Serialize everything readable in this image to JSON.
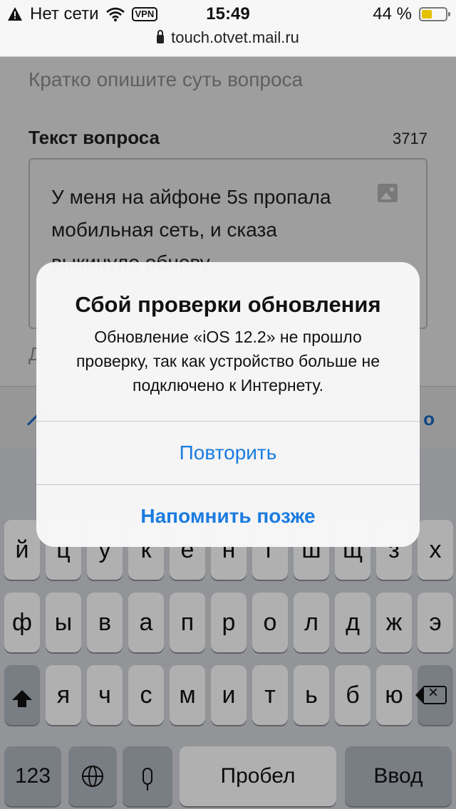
{
  "status_bar": {
    "carrier": "Нет сети",
    "vpn_label": "VPN",
    "time": "15:49",
    "battery_text": "44 %",
    "battery_level": 0.44,
    "url": "touch.otvet.mail.ru"
  },
  "form": {
    "summary_placeholder": "Кратко опишите суть вопроса",
    "question_label": "Текст вопроса",
    "char_counter": "3717",
    "question_text": "У меня на айфоне 5s пропала мобильная сеть, и сказа выкинуло обнову",
    "partial_label": "Д",
    "toolbar_partial": "о"
  },
  "alert": {
    "title": "Сбой проверки обновления",
    "message": "Обновление «iOS 12.2» не прошло проверку, так как устройство больше не подключено к Интернету.",
    "retry_label": "Повторить",
    "later_label": "Напомнить позже"
  },
  "keyboard": {
    "row1": [
      "й",
      "ц",
      "у",
      "к",
      "е",
      "н",
      "г",
      "ш",
      "щ",
      "з",
      "х"
    ],
    "row2": [
      "ф",
      "ы",
      "в",
      "а",
      "п",
      "р",
      "о",
      "л",
      "д",
      "ж",
      "э"
    ],
    "row3": [
      "я",
      "ч",
      "с",
      "м",
      "и",
      "т",
      "ь",
      "б",
      "ю"
    ],
    "numbers_label": "123",
    "space_label": "Пробел",
    "enter_label": "Ввод"
  },
  "icons": {
    "warning": "warning-icon",
    "wifi": "wifi-icon",
    "lock": "lock-icon",
    "image": "image-icon",
    "shift": "shift-icon",
    "backspace": "backspace-icon",
    "globe": "globe-icon",
    "mic": "microphone-icon"
  }
}
